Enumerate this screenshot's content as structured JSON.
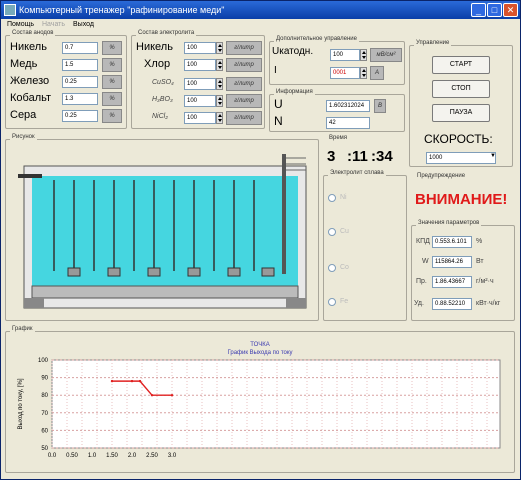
{
  "window": {
    "title": "Компьютерный тренажер \"рафинирование меди\"",
    "min_icon": "minimize-icon",
    "max_icon": "maximize-icon",
    "close_icon": "close-icon"
  },
  "menu": {
    "items": [
      "Помощь",
      "Начать",
      "Выход"
    ]
  },
  "anode": {
    "title": "Состав анодов",
    "rows": [
      {
        "name": "Никель",
        "value": "0.7",
        "unit": "%"
      },
      {
        "name": "Медь",
        "value": "1.5",
        "unit": "%"
      },
      {
        "name": "Железо",
        "value": "0.25",
        "unit": "%"
      },
      {
        "name": "Кобальт",
        "value": "1.3",
        "unit": "%"
      },
      {
        "name": "Сера",
        "value": "0.25",
        "unit": "%"
      }
    ]
  },
  "electrolyte": {
    "title": "Состав электролита",
    "rows": [
      {
        "name": "Никель",
        "value": "100",
        "unit": "г/литр"
      },
      {
        "name": "Хлор",
        "value": "100",
        "unit": "г/литр"
      },
      {
        "name": "CuSO₄",
        "value": "100",
        "unit": "г/литр"
      },
      {
        "name": "H₃BO₃",
        "value": "100",
        "unit": "г/литр"
      },
      {
        "name": "NiCl₂",
        "value": "100",
        "unit": "г/литр"
      }
    ]
  },
  "control": {
    "title": "Дополнительное управление",
    "voltage_label": "Uкатодн.",
    "voltage_value": "100",
    "voltage_unit": "мВ/см²",
    "current_label": "I",
    "current_value": "0001",
    "current_unit": "А"
  },
  "info": {
    "title": "Информация",
    "u_label": "U",
    "u_value": "1.602312024",
    "u_unit": "В",
    "n_label": "N",
    "n_value": "42"
  },
  "management": {
    "title": "Управление",
    "start": "СТАРТ",
    "stop": "СТОП",
    "pause": "ПАУЗА",
    "speed_label": "СКОРОСТЬ:",
    "speed_value": "1000"
  },
  "picture_title": "Рисунок",
  "time": {
    "title": "Время",
    "h": "3",
    "m": ":11",
    "s": ":34"
  },
  "electrode": {
    "title": "Электролит сплава",
    "options": [
      "Ni",
      "Cu",
      "Co",
      "Fe"
    ]
  },
  "warning": {
    "title": "Предупреждение",
    "text": "ВНИМАНИЕ!"
  },
  "params": {
    "title": "Значения параметров",
    "rows": [
      {
        "name": "КПД",
        "value": "0.553.6.101",
        "unit": "%"
      },
      {
        "name": "W",
        "value": "115864.26",
        "unit": "Вт"
      },
      {
        "name": "Пр.",
        "value": "1.86.43667",
        "unit": "г/м²·ч"
      },
      {
        "name": "Уд.",
        "value": "0.88.52210",
        "unit": "кВт·ч/кг"
      }
    ]
  },
  "chart_panel_title": "График",
  "chart_data": {
    "type": "line",
    "title": "ТОЧКА",
    "subtitle": "График Выхода по току",
    "ylabel": "Выход по току, [%]",
    "ylim": [
      50,
      100
    ],
    "yticks": [
      "100",
      "90",
      "80",
      "70",
      "60",
      "50"
    ],
    "xticks": [
      "0.0",
      "0.50",
      "1.0",
      "1.50",
      "2.0",
      "2.50",
      "3.0"
    ],
    "x": [
      1.5,
      2.0,
      2.2,
      2.5,
      3.0
    ],
    "values": [
      88,
      88,
      88,
      80,
      80
    ],
    "color": "#e02020",
    "grid": true
  }
}
